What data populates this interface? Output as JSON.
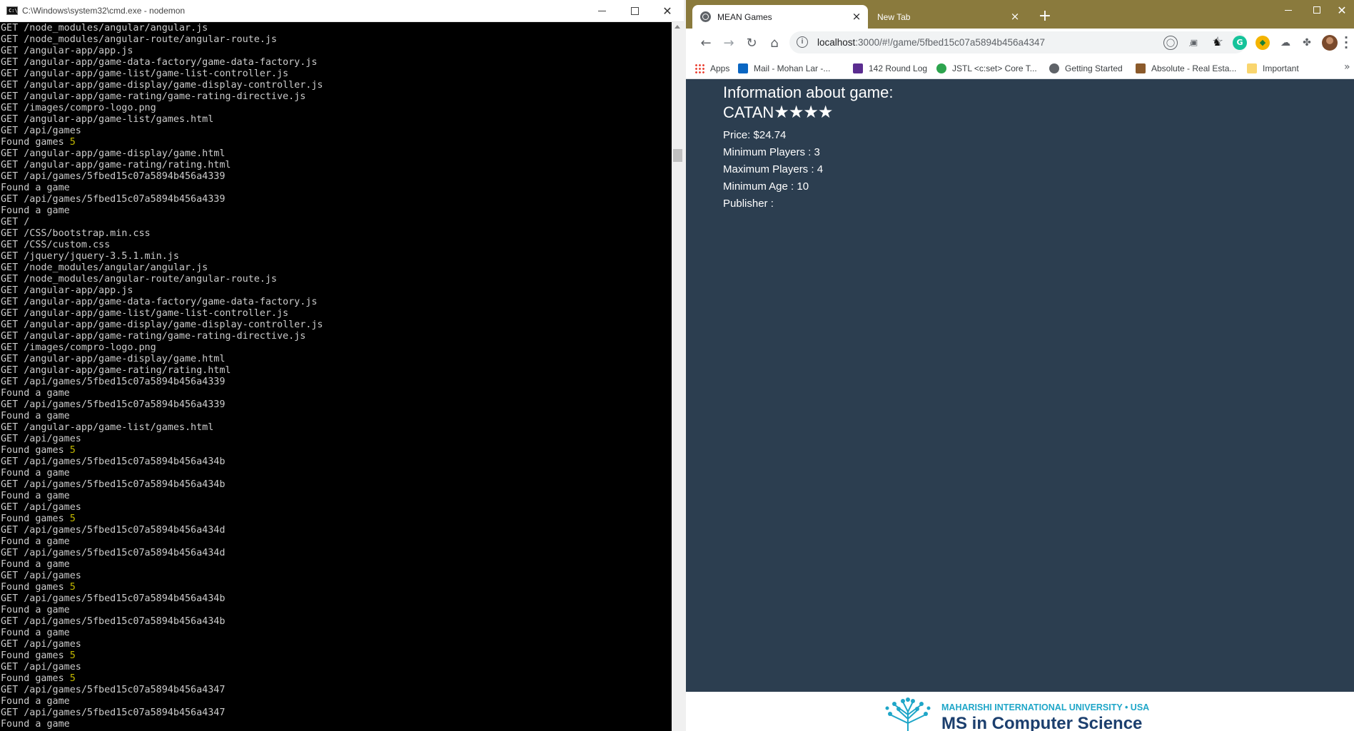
{
  "cmd": {
    "title": "C:\\Windows\\system32\\cmd.exe - nodemon",
    "lines": [
      "GET /node_modules/angular/angular.js",
      "GET /node_modules/angular-route/angular-route.js",
      "GET /angular-app/app.js",
      "GET /angular-app/game-data-factory/game-data-factory.js",
      "GET /angular-app/game-list/game-list-controller.js",
      "GET /angular-app/game-display/game-display-controller.js",
      "GET /angular-app/game-rating/game-rating-directive.js",
      "GET /images/compro-logo.png",
      "GET /angular-app/game-list/games.html",
      "GET /api/games",
      "Found games 5",
      "GET /angular-app/game-display/game.html",
      "GET /angular-app/game-rating/rating.html",
      "GET /api/games/5fbed15c07a5894b456a4339",
      "Found a game",
      "GET /api/games/5fbed15c07a5894b456a4339",
      "Found a game",
      "GET /",
      "GET /CSS/bootstrap.min.css",
      "GET /CSS/custom.css",
      "GET /jquery/jquery-3.5.1.min.js",
      "GET /node_modules/angular/angular.js",
      "GET /node_modules/angular-route/angular-route.js",
      "GET /angular-app/app.js",
      "GET /angular-app/game-data-factory/game-data-factory.js",
      "GET /angular-app/game-list/game-list-controller.js",
      "GET /angular-app/game-display/game-display-controller.js",
      "GET /angular-app/game-rating/game-rating-directive.js",
      "GET /images/compro-logo.png",
      "GET /angular-app/game-display/game.html",
      "GET /angular-app/game-rating/rating.html",
      "GET /api/games/5fbed15c07a5894b456a4339",
      "Found a game",
      "GET /api/games/5fbed15c07a5894b456a4339",
      "Found a game",
      "GET /angular-app/game-list/games.html",
      "GET /api/games",
      "Found games 5",
      "GET /api/games/5fbed15c07a5894b456a434b",
      "Found a game",
      "GET /api/games/5fbed15c07a5894b456a434b",
      "Found a game",
      "GET /api/games",
      "Found games 5",
      "GET /api/games/5fbed15c07a5894b456a434d",
      "Found a game",
      "GET /api/games/5fbed15c07a5894b456a434d",
      "Found a game",
      "GET /api/games",
      "Found games 5",
      "GET /api/games/5fbed15c07a5894b456a434b",
      "Found a game",
      "GET /api/games/5fbed15c07a5894b456a434b",
      "Found a game",
      "GET /api/games",
      "Found games 5",
      "GET /api/games",
      "Found games 5",
      "GET /api/games/5fbed15c07a5894b456a4347",
      "Found a game",
      "GET /api/games/5fbed15c07a5894b456a4347",
      "Found a game"
    ],
    "number_color": "#c2b800"
  },
  "browser": {
    "tabs": [
      {
        "label": "MEAN Games",
        "active": true
      },
      {
        "label": "New Tab",
        "active": false
      }
    ],
    "url_host": "localhost",
    "url_rest": ":3000/#!/game/5fbed15c07a5894b456a4347",
    "bookmarks": [
      {
        "label": "Apps",
        "icon": "apps-grid-icon"
      },
      {
        "label": "Mail - Mohan Lar -...",
        "icon": "outlook-icon"
      },
      {
        "label": "142 Round Log",
        "icon": "list-icon"
      },
      {
        "label": "JSTL <c:set> Core T...",
        "icon": "jstl-icon"
      },
      {
        "label": "Getting Started",
        "icon": "globe-icon"
      },
      {
        "label": "Absolute - Real Esta...",
        "icon": "absolute-icon"
      },
      {
        "label": "Important",
        "icon": "folder-icon"
      }
    ],
    "tabstrip_color": "#8a7a3d",
    "page_bg": "#2c3e50"
  },
  "game": {
    "heading": "Information about game:",
    "title": "CATAN",
    "stars": "★★★★",
    "rating": 4,
    "price": "Price: $24.74",
    "min_players": "Minimum Players : 3",
    "max_players": "Maximum Players : 4",
    "min_age": "Minimum Age : 10",
    "publisher": "Publisher :"
  },
  "footer": {
    "university": "MAHARISHI INTERNATIONAL UNIVERSITY • USA",
    "program": "MS in Computer Science"
  }
}
